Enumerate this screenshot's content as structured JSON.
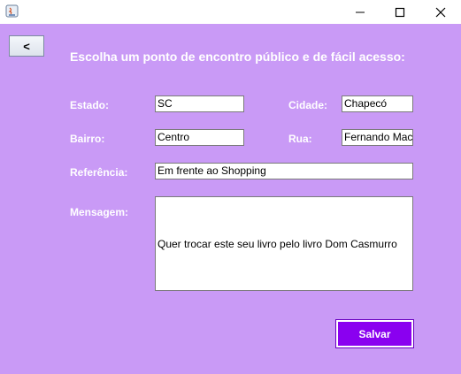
{
  "window": {
    "icon": "java-icon",
    "controls": [
      "minimize-icon",
      "maximize-icon",
      "close-icon"
    ]
  },
  "back_button": {
    "label": "<"
  },
  "heading": "Escolha um ponto de encontro público e de fácil acesso:",
  "form": {
    "estado": {
      "label": "Estado:",
      "value": "SC"
    },
    "cidade": {
      "label": "Cidade:",
      "value": "Chapecó"
    },
    "bairro": {
      "label": "Bairro:",
      "value": "Centro"
    },
    "rua": {
      "label": "Rua:",
      "value": "Fernando Mac"
    },
    "referencia": {
      "label": "Referência:",
      "value": "Em frente ao Shopping"
    },
    "mensagem": {
      "label": "Mensagem:",
      "value": "Quer trocar este seu livro pelo livro Dom Casmurro"
    }
  },
  "save_button": {
    "label": "Salvar"
  },
  "colors": {
    "background": "#c99af6",
    "save_button": "#8a00f0",
    "text": "#ffffff"
  }
}
